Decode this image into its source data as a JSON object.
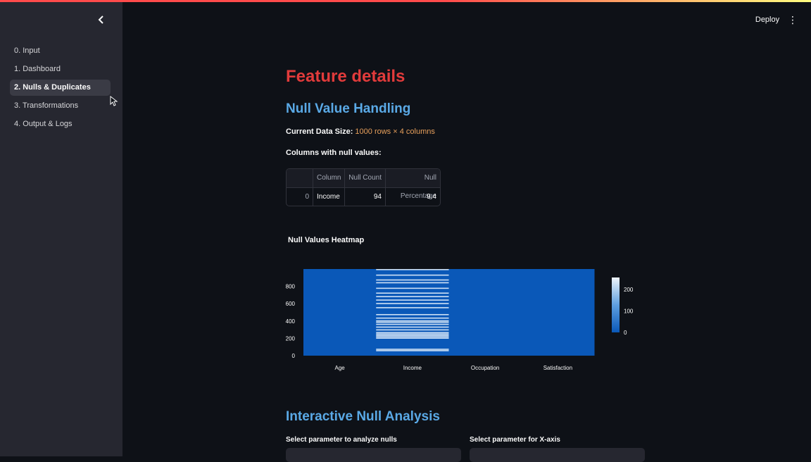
{
  "sidebar": {
    "items": [
      {
        "label": "0. Input",
        "active": false
      },
      {
        "label": "1. Dashboard",
        "active": false
      },
      {
        "label": "2. Nulls & Duplicates",
        "active": true
      },
      {
        "label": "3. Transformations",
        "active": false
      },
      {
        "label": "4. Output & Logs",
        "active": false
      }
    ]
  },
  "header": {
    "deploy_label": "Deploy",
    "menu_icon": "⋮"
  },
  "main": {
    "title": "Feature details",
    "section1_title": "Null Value Handling",
    "data_size_label": "Current Data Size:",
    "data_size_value": "1000 rows × 4 columns",
    "null_columns_label": "Columns with null values:",
    "table": {
      "headers": [
        "",
        "Column",
        "Null Count",
        "Null Percentage"
      ],
      "rows": [
        [
          "0",
          "Income",
          "94",
          "9.4"
        ]
      ]
    },
    "section2_title": "Interactive Null Analysis",
    "select1_label": "Select parameter to analyze nulls",
    "select2_label": "Select parameter for X-axis"
  },
  "chart_data": {
    "type": "heatmap",
    "title": "Null Values Heatmap",
    "categories": [
      "Age",
      "Income",
      "Occupation",
      "Satisfaction"
    ],
    "y_ticks": [
      0,
      200,
      400,
      600,
      800
    ],
    "ylim": [
      0,
      1000
    ],
    "null_rows": {
      "Income": [
        56,
        72,
        200,
        216,
        232,
        248,
        264,
        296,
        328,
        360,
        384,
        400,
        432,
        472,
        552,
        600,
        640,
        680,
        720,
        776,
        840,
        872,
        928,
        992
      ]
    },
    "colorbar": {
      "ticks": [
        0,
        100,
        200
      ],
      "range": [
        0,
        255
      ]
    },
    "colors": {
      "base": "#0a58b8",
      "null": "#cfe1f5"
    }
  },
  "colors": {
    "accent_red": "#e23b3b",
    "accent_blue": "#5aa9e6",
    "value_orange": "#e8a05c"
  }
}
